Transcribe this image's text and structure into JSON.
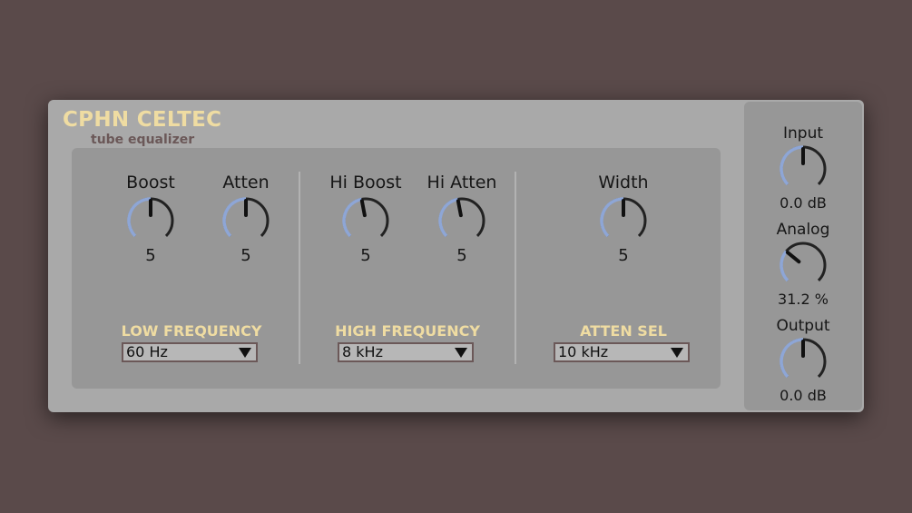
{
  "device": {
    "title": "CPHN CELTEC",
    "subtitle": "tube equalizer"
  },
  "colors": {
    "background": "#5a4a4a",
    "panel": "#a9a9a9",
    "inner_panel": "#979797",
    "accent_text": "#efdca2",
    "knob_arc": "#8ea6d6",
    "knob_pointer": "#111111"
  },
  "low": {
    "boost": {
      "label": "Boost",
      "value": "5",
      "level": 0.5
    },
    "atten": {
      "label": "Atten",
      "value": "5",
      "level": 0.5
    },
    "section_label": "LOW FREQUENCY",
    "frequency": "60 Hz"
  },
  "high": {
    "boost": {
      "label": "Hi Boost",
      "value": "5",
      "level": 0.46
    },
    "atten": {
      "label": "Hi Atten",
      "value": "5",
      "level": 0.46
    },
    "section_label": "HIGH FREQUENCY",
    "frequency": "8 kHz"
  },
  "atten_sel": {
    "width": {
      "label": "Width",
      "value": "5",
      "level": 0.5
    },
    "section_label": "ATTEN SEL",
    "frequency": "10 kHz"
  },
  "side": {
    "input": {
      "label": "Input",
      "value": "0.0 dB",
      "level": 0.5
    },
    "analog": {
      "label": "Analog",
      "value": "31.2 %",
      "level": 0.312
    },
    "output": {
      "label": "Output",
      "value": "0.0 dB",
      "level": 0.5
    }
  }
}
